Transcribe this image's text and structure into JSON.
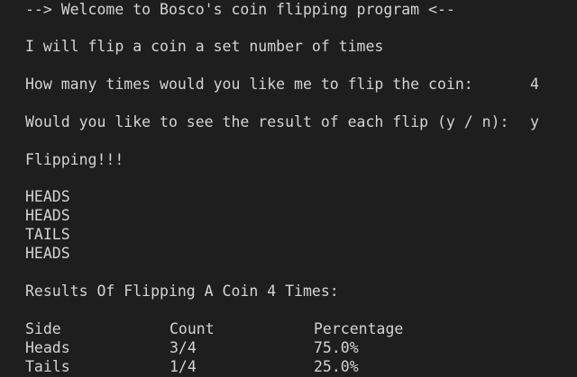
{
  "terminal": {
    "welcome": "--> Welcome to Bosco's coin flipping program <--",
    "intro": "I will flip a coin a set number of times",
    "prompt_times": {
      "question": "How many times would you like me to flip the coin:",
      "answer": "4"
    },
    "prompt_show": {
      "question": "Would you like to see the result of each flip (y / n):",
      "answer": "y"
    },
    "flipping": "Flipping!!!",
    "flips": [
      "HEADS",
      "HEADS",
      "TAILS",
      "HEADS"
    ],
    "results_title": "Results Of Flipping A Coin 4 Times:",
    "table": {
      "headers": [
        "Side",
        "Count",
        "Percentage"
      ],
      "rows": [
        [
          "Heads",
          "3/4",
          "75.0%"
        ],
        [
          "Tails",
          "1/4",
          "25.0%"
        ]
      ]
    }
  },
  "colors": {
    "background": "#1e1e1e",
    "text": "#d4d4d4"
  }
}
